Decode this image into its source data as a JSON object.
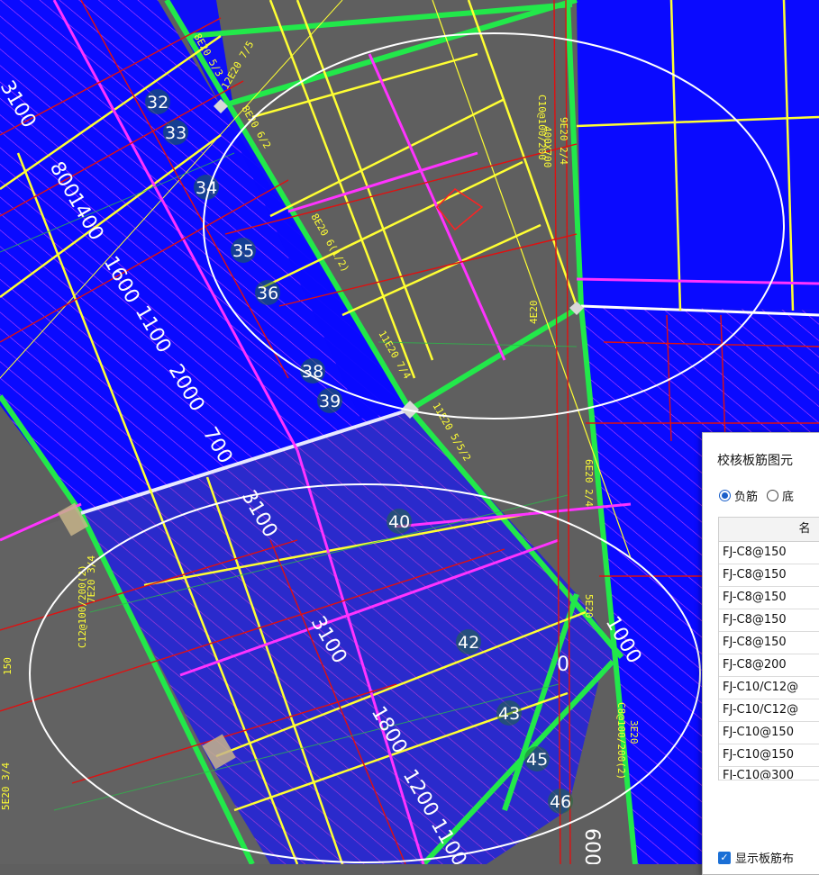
{
  "drawing": {
    "dimensions": [
      {
        "id": "d3100a",
        "text": "3100"
      },
      {
        "id": "d800",
        "text": "800"
      },
      {
        "id": "d1400",
        "text": "1400"
      },
      {
        "id": "d1600",
        "text": "1600"
      },
      {
        "id": "d1100",
        "text": "1100"
      },
      {
        "id": "d2000",
        "text": "2000"
      },
      {
        "id": "d700",
        "text": "700"
      },
      {
        "id": "d3100b",
        "text": "3100"
      },
      {
        "id": "d3100c",
        "text": "3100"
      },
      {
        "id": "d1800",
        "text": "1800"
      },
      {
        "id": "d1200",
        "text": "1200"
      },
      {
        "id": "d1100b",
        "text": "1100"
      },
      {
        "id": "d1000",
        "text": "1000"
      },
      {
        "id": "d0",
        "text": "0"
      },
      {
        "id": "d600",
        "text": "600"
      }
    ],
    "markers": [
      "32",
      "33",
      "34",
      "35",
      "36",
      "38",
      "39",
      "40",
      "42",
      "43",
      "45",
      "46"
    ],
    "rebar_labels": {
      "a": "8E20 5/3",
      "b": "12E20 7/5",
      "c": "8E20 6/2",
      "d": "C10@100/200",
      "e": "9E20 2/4",
      "f": "400X700",
      "g": "8E20 6(1/2)",
      "h": "4E20",
      "i": "11E20 7/4",
      "j": "11E20 5/5/2",
      "k": "6E20 2/4",
      "l": "7E20 3/4",
      "m": "C12@100/200(2)",
      "n": "C8@100/200(2)",
      "o": "3E20",
      "p": "5E20 3/4",
      "q": "5E20",
      "r": "150"
    }
  },
  "panel": {
    "title": "校核板筋图元",
    "radio_negative": "负筋",
    "radio_bottom": "底",
    "column_header": "名",
    "rows": [
      "FJ-C8@150",
      "FJ-C8@150",
      "FJ-C8@150",
      "FJ-C8@150",
      "FJ-C8@150",
      "FJ-C8@200",
      "FJ-C10/C12@",
      "FJ-C10/C12@",
      "FJ-C10@150",
      "FJ-C10@150",
      "FJ-C10@300"
    ],
    "checkbox_label": "显示板筋布"
  },
  "colors": {
    "background": "#5f5f5f",
    "slab_blue": "#0a0aff",
    "green_beam": "#22e84a",
    "yellow": "#ffff33",
    "magenta": "#ff33ff",
    "red": "#e01010",
    "annotation": "#ffffff"
  }
}
